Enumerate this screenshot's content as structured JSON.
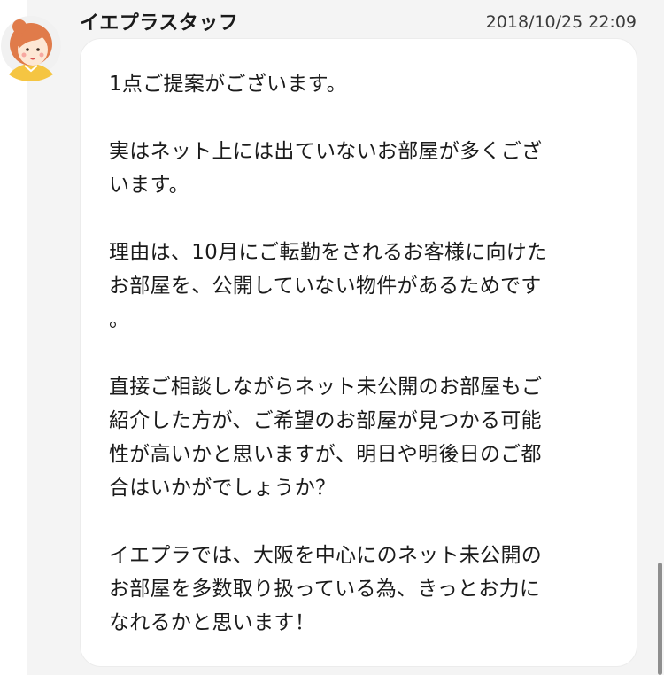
{
  "message": {
    "sender_name": "イエプラスタッフ",
    "timestamp": "2018/10/25 22:09",
    "avatar_icon": "staff-avatar-icon",
    "paragraphs": [
      {
        "lines": [
          "1点ご提案がございます。"
        ]
      },
      {
        "lines": [
          "実はネット上には出ていないお部屋が多くござ",
          "います。"
        ]
      },
      {
        "lines": [
          "理由は、10月にご転勤をされるお客様に向けた",
          "お部屋を、公開していない物件があるためです",
          "。"
        ]
      },
      {
        "lines": [
          "直接ご相談しながらネット未公開のお部屋もご",
          "紹介した方が、ご希望のお部屋が見つかる可能",
          "性が高いかと思いますが、明日や明後日のご都",
          "合はいかがでしょうか？"
        ]
      },
      {
        "lines": [
          "イエプラでは、大阪を中心にのネット未公開の",
          "お部屋を多数取り扱っている為、きっとお力に",
          "なれるかと思います！"
        ]
      }
    ]
  },
  "colors": {
    "background": "#f4f4f4",
    "bubble": "#ffffff",
    "text": "#1b1b1b"
  }
}
